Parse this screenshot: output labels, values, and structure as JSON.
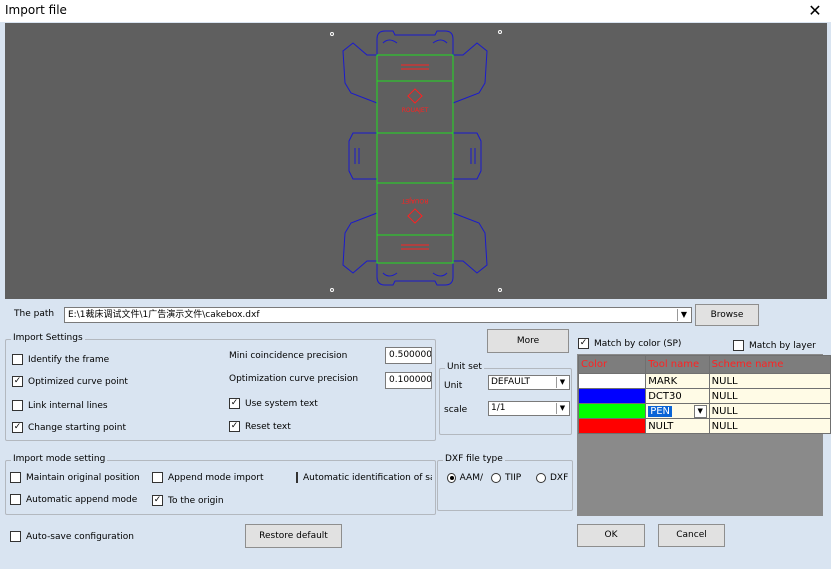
{
  "window": {
    "title": "Import file",
    "close_glyph": "✕"
  },
  "preview": {
    "brand_text": "ROUAJET"
  },
  "path": {
    "label": "The path",
    "value": "E:\\1裁床调试文件\\1广告演示文件\\cakebox.dxf",
    "browse_label": "Browse"
  },
  "import_settings": {
    "title": "Import Settings",
    "identify_frame": {
      "label": "Identify the frame",
      "checked": false
    },
    "optimized_curve_point": {
      "label": "Optimized curve point",
      "checked": true
    },
    "link_internal_lines": {
      "label": "Link internal lines",
      "checked": false
    },
    "change_starting_point": {
      "label": "Change starting point",
      "checked": true
    },
    "mini_coincidence_label": "Mini  coincidence precision",
    "mini_coincidence_value": "0.500000",
    "opt_curve_precision_label": "Optimization curve precision",
    "opt_curve_precision_value": "0.100000",
    "use_system_text": {
      "label": "Use system text",
      "checked": true
    },
    "reset_text": {
      "label": "Reset text",
      "checked": true
    }
  },
  "more_label": "More",
  "unit_set": {
    "title": "Unit set",
    "unit_label": "Unit",
    "unit_value": "DEFAULT",
    "scale_label": "scale",
    "scale_value": "1/1"
  },
  "match": {
    "by_color_label": "Match by color (SP)",
    "by_color_checked": true,
    "by_layer_label": "Match by layer",
    "by_layer_checked": false
  },
  "tool_table": {
    "headers": [
      "Color",
      "Tool name",
      "Scheme name"
    ],
    "rows": [
      {
        "color": "#ffffff",
        "tool": "MARK",
        "scheme": "NULL"
      },
      {
        "color": "#0000ff",
        "tool": "DCT30",
        "scheme": "NULL"
      },
      {
        "color": "#00ff00",
        "tool": "PEN",
        "scheme": "NULL"
      },
      {
        "color": "#ff0000",
        "tool": "NULT",
        "scheme": "NULL"
      }
    ]
  },
  "import_mode": {
    "title": "Import mode setting",
    "maintain_original": {
      "label": "Maintain original position",
      "checked": false
    },
    "append_mode_import": {
      "label": "Append mode import",
      "checked": false
    },
    "auto_identification": {
      "label": "Automatic identification of sam",
      "checked": false
    },
    "auto_append_mode": {
      "label": "Automatic append mode",
      "checked": false
    },
    "to_origin": {
      "label": "To the origin",
      "checked": true
    }
  },
  "dxf": {
    "title": "DXF file type",
    "options": [
      "AAM/",
      "TIIP",
      "DXF"
    ],
    "selected": 0
  },
  "auto_save": {
    "label": "Auto-save configuration",
    "checked": false
  },
  "restore_label": "Restore default",
  "ok_label": "OK",
  "cancel_label": "Cancel",
  "colors": {
    "cut_line": "#1a1acc",
    "crease_line": "#22dd22",
    "mark": "#ff2020",
    "preview_bg": "#5f5f5f",
    "dialog_bg": "#d9e4f1"
  }
}
